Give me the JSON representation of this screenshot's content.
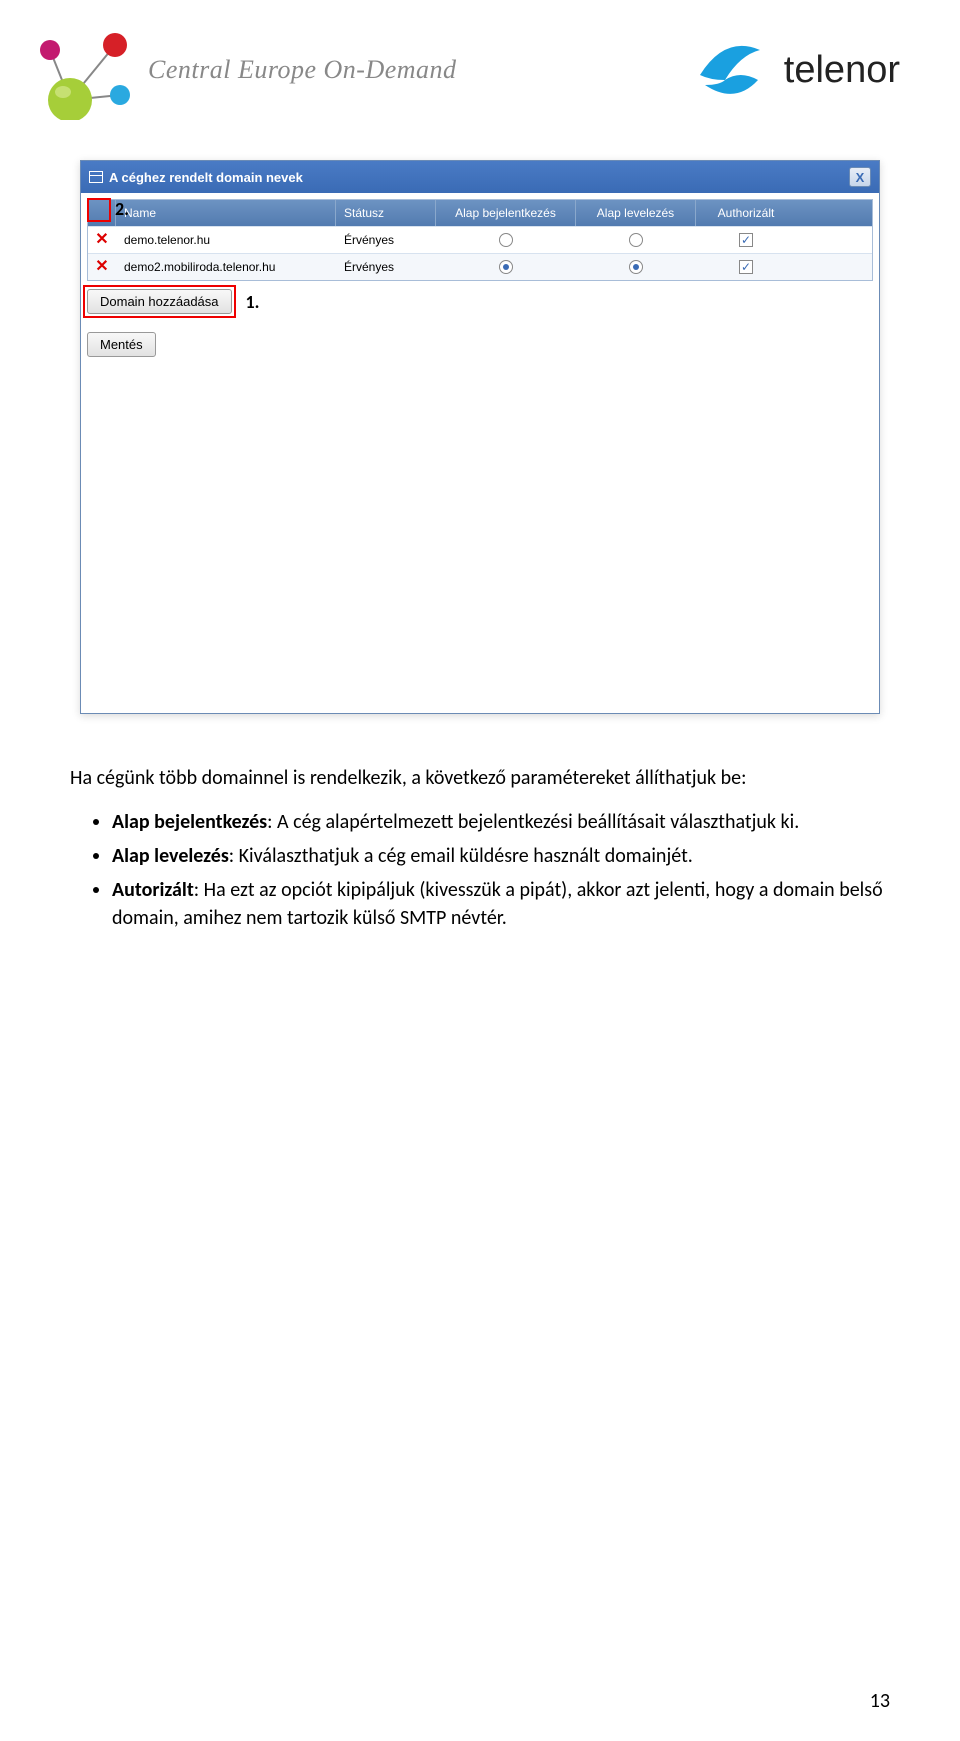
{
  "logos": {
    "ceod_text": "Central Europe On-Demand",
    "telenor_text": "telenor"
  },
  "dialog": {
    "title": "A céghez rendelt domain nevek",
    "close_glyph": "X",
    "columns": {
      "name": "Name",
      "status": "Státusz",
      "login": "Alap bejelentkezés",
      "mail": "Alap levelezés",
      "auth": "Authorizált"
    },
    "rows": [
      {
        "name": "demo.telenor.hu",
        "status": "Érvényes",
        "login_selected": false,
        "mail_selected": false,
        "auth_checked": true
      },
      {
        "name": "demo2.mobiliroda.telenor.hu",
        "status": "Érvényes",
        "login_selected": true,
        "mail_selected": true,
        "auth_checked": true
      }
    ],
    "add_button": "Domain hozzáadása",
    "save_button": "Mentés"
  },
  "annotations": {
    "label1": "1.",
    "label2": "2."
  },
  "text": {
    "intro": "Ha cégünk több domainnel is rendelkezik, a következő paramétereket állíthatjuk be:",
    "bullets": [
      {
        "term": "Alap bejelentkezés",
        "def": ": A cég alapértelmezett bejelentkezési beállításait választhatjuk ki."
      },
      {
        "term": "Alap levelezés",
        "def": ": Kiválaszthatjuk a cég email küldésre használt domainjét."
      },
      {
        "term": "Autorizált",
        "def": ": Ha ezt az opciót kipipáljuk (kivesszük a pipát), akkor azt jelenti, hogy a domain belső domain, amihez nem tartozik külső SMTP névtér."
      }
    ]
  },
  "page_number": "13"
}
